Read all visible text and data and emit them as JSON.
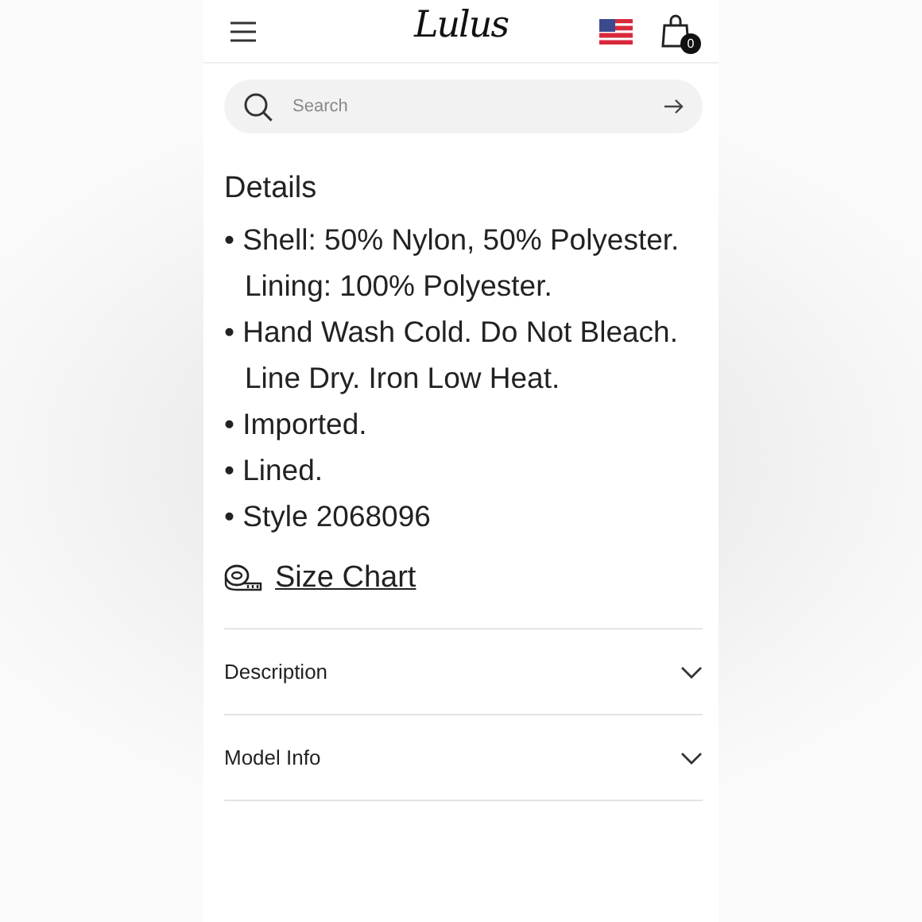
{
  "header": {
    "logo": "Lulus",
    "cart_count": "0"
  },
  "search": {
    "placeholder": "Search"
  },
  "details": {
    "title": "Details",
    "items": [
      "• Shell: 50% Nylon, 50% Polyester. Lining: 100% Polyester.",
      "• Hand Wash Cold. Do Not Bleach. Line Dry. Iron Low Heat.",
      "• Imported.",
      "• Lined.",
      "• Style 2068096"
    ],
    "size_chart": "Size Chart"
  },
  "sections": [
    {
      "label": "Description",
      "expanded": false
    },
    {
      "label": "Model Info",
      "expanded": false
    }
  ]
}
